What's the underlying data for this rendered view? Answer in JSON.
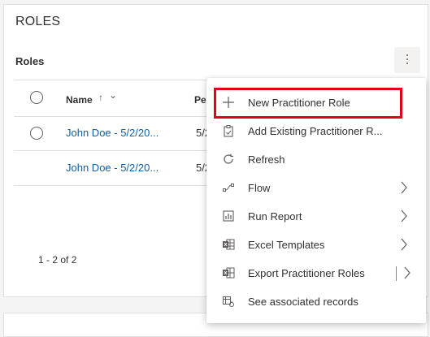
{
  "section": {
    "title": "ROLES",
    "subgrid_title": "Roles"
  },
  "grid": {
    "columns": {
      "name": "Name",
      "per": "Per"
    },
    "rows": [
      {
        "name": "John Doe - 5/2/20...",
        "date": "5/2",
        "has_radio": true
      },
      {
        "name": "John Doe - 5/2/20...",
        "date": "5/2",
        "has_radio": false
      }
    ],
    "pager": "1 - 2 of 2"
  },
  "menu": {
    "items": [
      {
        "label": "New Practitioner Role",
        "icon": "plus-icon",
        "has_submenu": false
      },
      {
        "label": "Add Existing Practitioner R...",
        "icon": "clipboard-icon",
        "has_submenu": false
      },
      {
        "label": "Refresh",
        "icon": "refresh-icon",
        "has_submenu": false
      },
      {
        "label": "Flow",
        "icon": "flow-icon",
        "has_submenu": true
      },
      {
        "label": "Run Report",
        "icon": "report-icon",
        "has_submenu": true
      },
      {
        "label": "Excel Templates",
        "icon": "excel-icon",
        "has_submenu": true
      },
      {
        "label": "Export Practitioner Roles",
        "icon": "export-excel-icon",
        "has_submenu": true
      },
      {
        "label": "See associated records",
        "icon": "associated-records-icon",
        "has_submenu": false
      }
    ]
  },
  "colors": {
    "link": "#115ea3",
    "highlight_border": "#e3001b",
    "text": "#323130"
  }
}
